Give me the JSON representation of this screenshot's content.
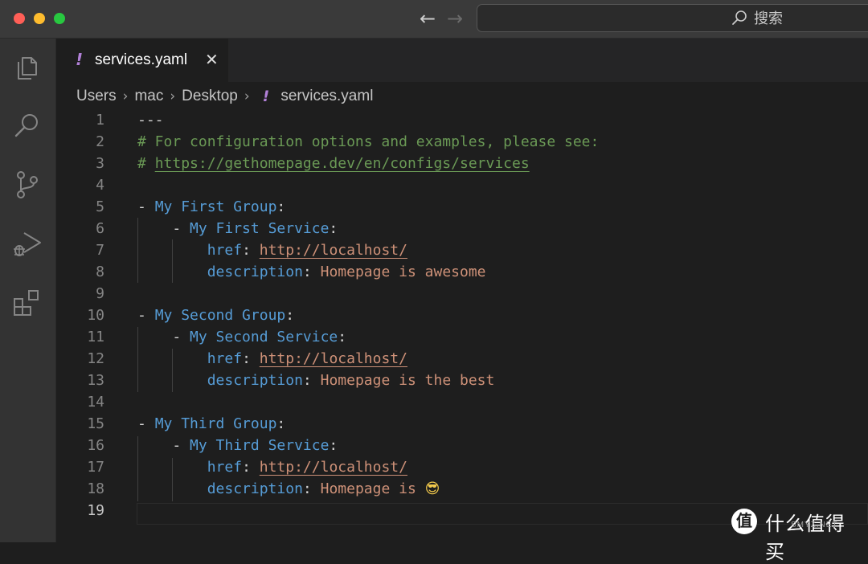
{
  "titlebar": {
    "search_label": "搜索"
  },
  "activity_bar": {
    "items": [
      "explorer-icon",
      "search-icon",
      "source-control-icon",
      "run-debug-icon",
      "extensions-icon"
    ]
  },
  "tab": {
    "icon": "!",
    "label": "services.yaml",
    "close_glyph": "✕"
  },
  "breadcrumb": {
    "items": [
      "Users",
      "mac",
      "Desktop",
      "services.yaml"
    ],
    "file_icon": "!"
  },
  "editor": {
    "language": "yaml",
    "active_line": 19,
    "lines": [
      {
        "n": "1",
        "tokens": [
          {
            "t": "---",
            "c": "dash"
          }
        ]
      },
      {
        "n": "2",
        "tokens": [
          {
            "t": "# For configuration options and examples, please see:",
            "c": "cmt"
          }
        ]
      },
      {
        "n": "3",
        "tokens": [
          {
            "t": "# ",
            "c": "cmt"
          },
          {
            "t": "https://gethomepage.dev/en/configs/services",
            "c": "cmtlink"
          }
        ]
      },
      {
        "n": "4",
        "tokens": []
      },
      {
        "n": "5",
        "tokens": [
          {
            "t": "- ",
            "c": "dash"
          },
          {
            "t": "My First Group",
            "c": "key"
          },
          {
            "t": ":",
            "c": "punc"
          }
        ]
      },
      {
        "n": "6",
        "tokens": [
          {
            "t": "    - ",
            "c": "dash"
          },
          {
            "t": "My First Service",
            "c": "key"
          },
          {
            "t": ":",
            "c": "punc"
          }
        ]
      },
      {
        "n": "7",
        "tokens": [
          {
            "t": "        ",
            "c": "punc"
          },
          {
            "t": "href",
            "c": "key"
          },
          {
            "t": ": ",
            "c": "punc"
          },
          {
            "t": "http://localhost/",
            "c": "link"
          }
        ]
      },
      {
        "n": "8",
        "tokens": [
          {
            "t": "        ",
            "c": "punc"
          },
          {
            "t": "description",
            "c": "key"
          },
          {
            "t": ": ",
            "c": "punc"
          },
          {
            "t": "Homepage is awesome",
            "c": "str"
          }
        ]
      },
      {
        "n": "9",
        "tokens": []
      },
      {
        "n": "10",
        "tokens": [
          {
            "t": "- ",
            "c": "dash"
          },
          {
            "t": "My Second Group",
            "c": "key"
          },
          {
            "t": ":",
            "c": "punc"
          }
        ]
      },
      {
        "n": "11",
        "tokens": [
          {
            "t": "    - ",
            "c": "dash"
          },
          {
            "t": "My Second Service",
            "c": "key"
          },
          {
            "t": ":",
            "c": "punc"
          }
        ]
      },
      {
        "n": "12",
        "tokens": [
          {
            "t": "        ",
            "c": "punc"
          },
          {
            "t": "href",
            "c": "key"
          },
          {
            "t": ": ",
            "c": "punc"
          },
          {
            "t": "http://localhost/",
            "c": "link"
          }
        ]
      },
      {
        "n": "13",
        "tokens": [
          {
            "t": "        ",
            "c": "punc"
          },
          {
            "t": "description",
            "c": "key"
          },
          {
            "t": ": ",
            "c": "punc"
          },
          {
            "t": "Homepage is the best",
            "c": "str"
          }
        ]
      },
      {
        "n": "14",
        "tokens": []
      },
      {
        "n": "15",
        "tokens": [
          {
            "t": "- ",
            "c": "dash"
          },
          {
            "t": "My Third Group",
            "c": "key"
          },
          {
            "t": ":",
            "c": "punc"
          }
        ]
      },
      {
        "n": "16",
        "tokens": [
          {
            "t": "    - ",
            "c": "dash"
          },
          {
            "t": "My Third Service",
            "c": "key"
          },
          {
            "t": ":",
            "c": "punc"
          }
        ]
      },
      {
        "n": "17",
        "tokens": [
          {
            "t": "        ",
            "c": "punc"
          },
          {
            "t": "href",
            "c": "key"
          },
          {
            "t": ": ",
            "c": "punc"
          },
          {
            "t": "http://localhost/",
            "c": "link"
          }
        ]
      },
      {
        "n": "18",
        "tokens": [
          {
            "t": "        ",
            "c": "punc"
          },
          {
            "t": "description",
            "c": "key"
          },
          {
            "t": ": ",
            "c": "punc"
          },
          {
            "t": "Homepage is ",
            "c": "str"
          },
          {
            "t": "😎",
            "c": "emoji"
          }
        ]
      },
      {
        "n": "19",
        "tokens": []
      }
    ]
  },
  "watermark": {
    "logo_glyph": "值",
    "text": "什么值得买",
    "sub": "SMYZ.NET"
  },
  "colors": {
    "editor_bg": "#1e1e1e",
    "key": "#569cd6",
    "string": "#ce9178",
    "comment": "#6a9955",
    "yaml_icon": "#b180d7"
  }
}
